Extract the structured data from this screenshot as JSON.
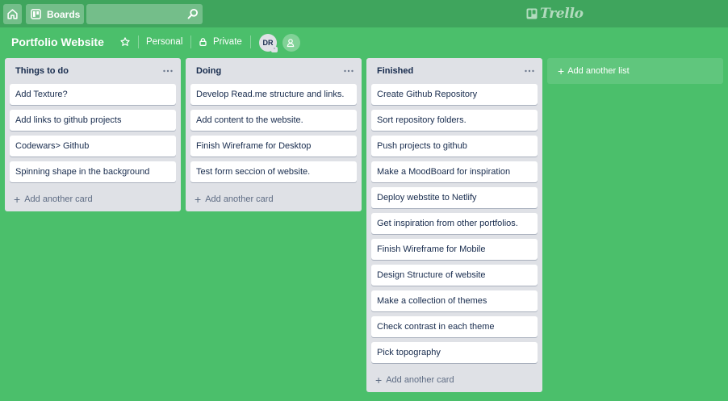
{
  "header": {
    "boards_label": "Boards",
    "search": {
      "value": "",
      "placeholder": ""
    },
    "logo_text": "Trello"
  },
  "board": {
    "title": "Portfolio Website",
    "team_label": "Personal",
    "visibility_label": "Private",
    "member_initials": "DR"
  },
  "lists": [
    {
      "title": "Things to do",
      "cards": [
        "Add Texture?",
        "Add links to github projects",
        "Codewars> Github",
        "Spinning shape in the background"
      ],
      "add_card_label": "Add another card"
    },
    {
      "title": "Doing",
      "cards": [
        "Develop Read.me structure and links.",
        "Add content to the website.",
        "Finish Wireframe for Desktop",
        "Test form seccion of website."
      ],
      "add_card_label": "Add another card"
    },
    {
      "title": "Finished",
      "cards": [
        "Create Github Repository",
        "Sort repository folders.",
        "Push projects to github",
        "Make a MoodBoard for inspiration",
        "Deploy webstite to Netlify",
        "Get inspiration from other portfolios.",
        "Finish Wireframe for Mobile",
        "Design Structure of website",
        "Make a collection of themes",
        "Check contrast in each theme",
        "Pick topography"
      ],
      "add_card_label": "Add another card"
    }
  ],
  "add_list_label": "Add another list",
  "colors": {
    "board_background": "#4bbf6b",
    "header_background": "#3fa55d",
    "list_background": "#dfe1e6",
    "card_background": "#ffffff"
  },
  "icons": [
    "home-icon",
    "boards-icon",
    "search-icon",
    "trello-logo-icon",
    "star-icon",
    "lock-icon",
    "add-member-icon",
    "more-icon",
    "plus-icon"
  ]
}
